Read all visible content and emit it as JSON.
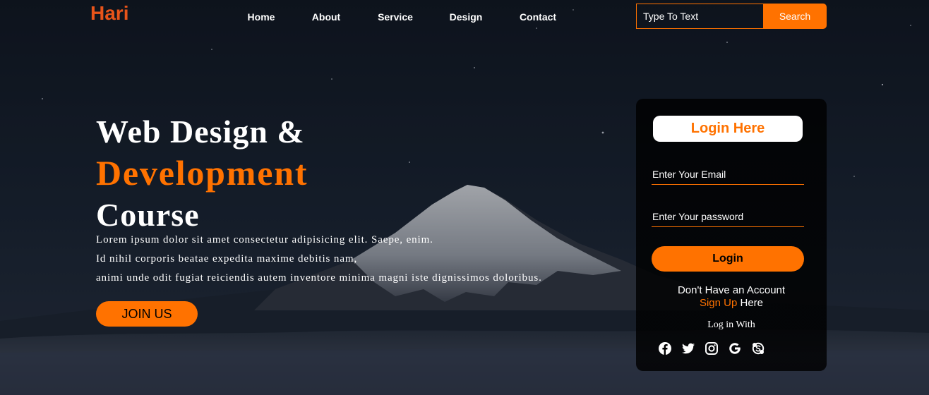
{
  "brand": {
    "logo": "Hari"
  },
  "nav": {
    "items": [
      "Home",
      "About",
      "Service",
      "Design",
      "Contact"
    ]
  },
  "search": {
    "placeholder": "Type To Text",
    "button": "Search"
  },
  "hero": {
    "line1": "Web Design &",
    "line2": "Development",
    "line3": "Course",
    "paragraph_lines": [
      "Lorem ipsum dolor sit amet consectetur adipisicing elit. Saepe, enim.",
      "Id nihil corporis beatae expedita maxime debitis nam,",
      "animi unde odit fugiat reiciendis autem inventore minima magni iste dignissimos doloribus."
    ],
    "join_button": "JOIN US"
  },
  "login": {
    "title": "Login Here",
    "email_placeholder": "Enter Your Email",
    "password_placeholder": "Enter Your password",
    "button": "Login",
    "no_account": "Don't Have an Account",
    "signup_link": "Sign Up",
    "signup_suffix": " Here",
    "login_with": "Log in With",
    "social_icons": [
      "facebook-icon",
      "twitter-icon",
      "instagram-icon",
      "google-icon",
      "skype-icon"
    ]
  },
  "colors": {
    "accent": "#ff7200",
    "logo": "#e8541a",
    "form_bg": "#000000"
  }
}
